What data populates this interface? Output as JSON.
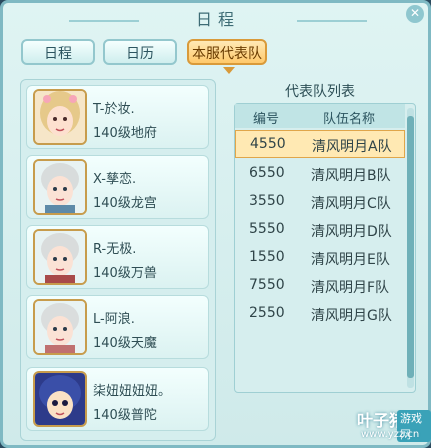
{
  "window": {
    "title": "日程",
    "close_glyph": "✕"
  },
  "tabs": [
    {
      "label": "日程",
      "active": false
    },
    {
      "label": "日历",
      "active": false
    },
    {
      "label": "本服代表队",
      "active": true
    }
  ],
  "members": [
    {
      "name": "T-於妆.",
      "level": "140级地府"
    },
    {
      "name": "X-孳恋.",
      "level": "140级龙宫"
    },
    {
      "name": "R-无极.",
      "level": "140级万兽"
    },
    {
      "name": "L-阿浪.",
      "level": "140级天魔"
    },
    {
      "name": "柒妞妞妞妞。",
      "level": "140级普陀"
    }
  ],
  "team_list": {
    "title": "代表队列表",
    "headers": {
      "num": "编号",
      "team": "队伍名称"
    },
    "rows": [
      {
        "num": "4550",
        "team": "清风明月A队",
        "selected": true
      },
      {
        "num": "6550",
        "team": "清风明月B队",
        "selected": false
      },
      {
        "num": "3550",
        "team": "清风明月C队",
        "selected": false
      },
      {
        "num": "5550",
        "team": "清风明月D队",
        "selected": false
      },
      {
        "num": "1550",
        "team": "清风明月E队",
        "selected": false
      },
      {
        "num": "7550",
        "team": "清风明月F队",
        "selected": false
      },
      {
        "num": "2550",
        "team": "清风明月G队",
        "selected": false
      }
    ]
  },
  "watermark": {
    "main": "叶子猪",
    "tag": "游戏网",
    "url": "www.yzz.cn"
  },
  "colors": {
    "accent": "#ffc96b",
    "panel": "#d5eeee",
    "border": "#7fb9c3"
  }
}
